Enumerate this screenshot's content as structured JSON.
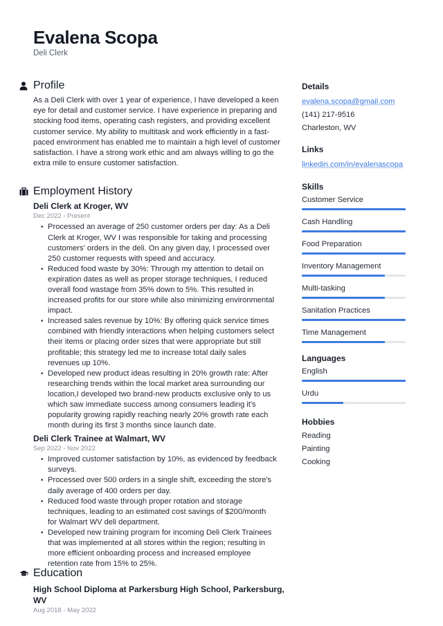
{
  "header": {
    "name": "Evalena Scopa",
    "job_title": "Deli Clerk"
  },
  "profile": {
    "title": "Profile",
    "icon": "person-icon",
    "text": "As a Deli Clerk with over 1 year of experience, I have developed a keen eye for detail and customer service. I have experience in preparing and stocking food items, operating cash registers, and providing excellent customer service. My ability to multitask and work efficiently in a fast-paced environment has enabled me to maintain a high level of customer satisfaction. I have a strong work ethic and am always willing to go the extra mile to ensure customer satisfaction."
  },
  "employment": {
    "title": "Employment History",
    "icon": "briefcase-icon",
    "jobs": [
      {
        "heading": "Deli Clerk at Kroger, WV",
        "dates": "Dec 2022 - Present",
        "bullets": [
          "Processed an average of 250 customer orders per day: As a Deli Clerk at Kroger, WV I was responsible for taking and processing customers' orders in the deli. On any given day, I processed over 250 customer requests with speed and accuracy.",
          "Reduced food waste by 30%: Through my attention to detail on expiration dates as well as proper storage techniques, I reduced overall food wastage from 35% down to 5%. This resulted in increased profits for our store while also minimizing environmental impact.",
          "Increased sales revenue by 10%: By offering quick service times combined with friendly interactions when helping customers select their items or placing order sizes that were appropriate but still profitable; this strategy led me to increase total daily sales revenues up 10%.",
          "Developed new product ideas resulting in 20% growth rate: After researching trends within the local market area surrounding our location,I developed two brand-new products exclusive only to us which saw immediate success among consumers leading it's popularity growing rapidly reaching nearly 20% growth rate each month during its first 3 months since launch date."
        ]
      },
      {
        "heading": "Deli Clerk Trainee at Walmart, WV",
        "dates": "Sep 2022 - Nov 2022",
        "bullets": [
          "Improved customer satisfaction by 10%, as evidenced by feedback surveys.",
          "Processed over 500 orders in a single shift, exceeding the store's daily average of 400 orders per day.",
          "Reduced food waste through proper rotation and storage techniques, leading to an estimated cost savings of $200/month for Walmart WV deli department.",
          "Developed new training program for incoming Deli Clerk Trainees that was implemented at all stores within the region; resulting in more efficient onboarding process and increased employee retention rate from 15% to 25%."
        ]
      }
    ]
  },
  "education": {
    "title": "Education",
    "icon": "graduation-cap-icon",
    "heading": "High School Diploma at Parkersburg High School, Parkersburg, WV",
    "dates": "Aug 2018 - May 2022"
  },
  "sidebar": {
    "details": {
      "title": "Details",
      "email": "evalena.scopa@gmail.com",
      "phone": "(141) 217-9516",
      "location": "Charleston, WV"
    },
    "links": {
      "title": "Links",
      "linkedin": "linkedin.com/in/evalenascopa"
    },
    "skills": {
      "title": "Skills",
      "items": [
        {
          "name": "Customer Service",
          "level": 1.0
        },
        {
          "name": "Cash Handling",
          "level": 1.0
        },
        {
          "name": "Food Preparation",
          "level": 1.0
        },
        {
          "name": "Inventory Management",
          "level": 0.8
        },
        {
          "name": "Multi-tasking",
          "level": 0.8
        },
        {
          "name": "Sanitation Practices",
          "level": 1.0
        },
        {
          "name": "Time Management",
          "level": 0.8
        }
      ]
    },
    "languages": {
      "title": "Languages",
      "items": [
        {
          "name": "English",
          "level": 1.0
        },
        {
          "name": "Urdu",
          "level": 0.4
        }
      ]
    },
    "hobbies": {
      "title": "Hobbies",
      "items": [
        "Reading",
        "Painting",
        "Cooking"
      ]
    }
  },
  "colors": {
    "accent": "#3b7ae0",
    "bar_track": "#e3e5e8",
    "text": "#1a1f2b",
    "muted": "#8a919c"
  }
}
